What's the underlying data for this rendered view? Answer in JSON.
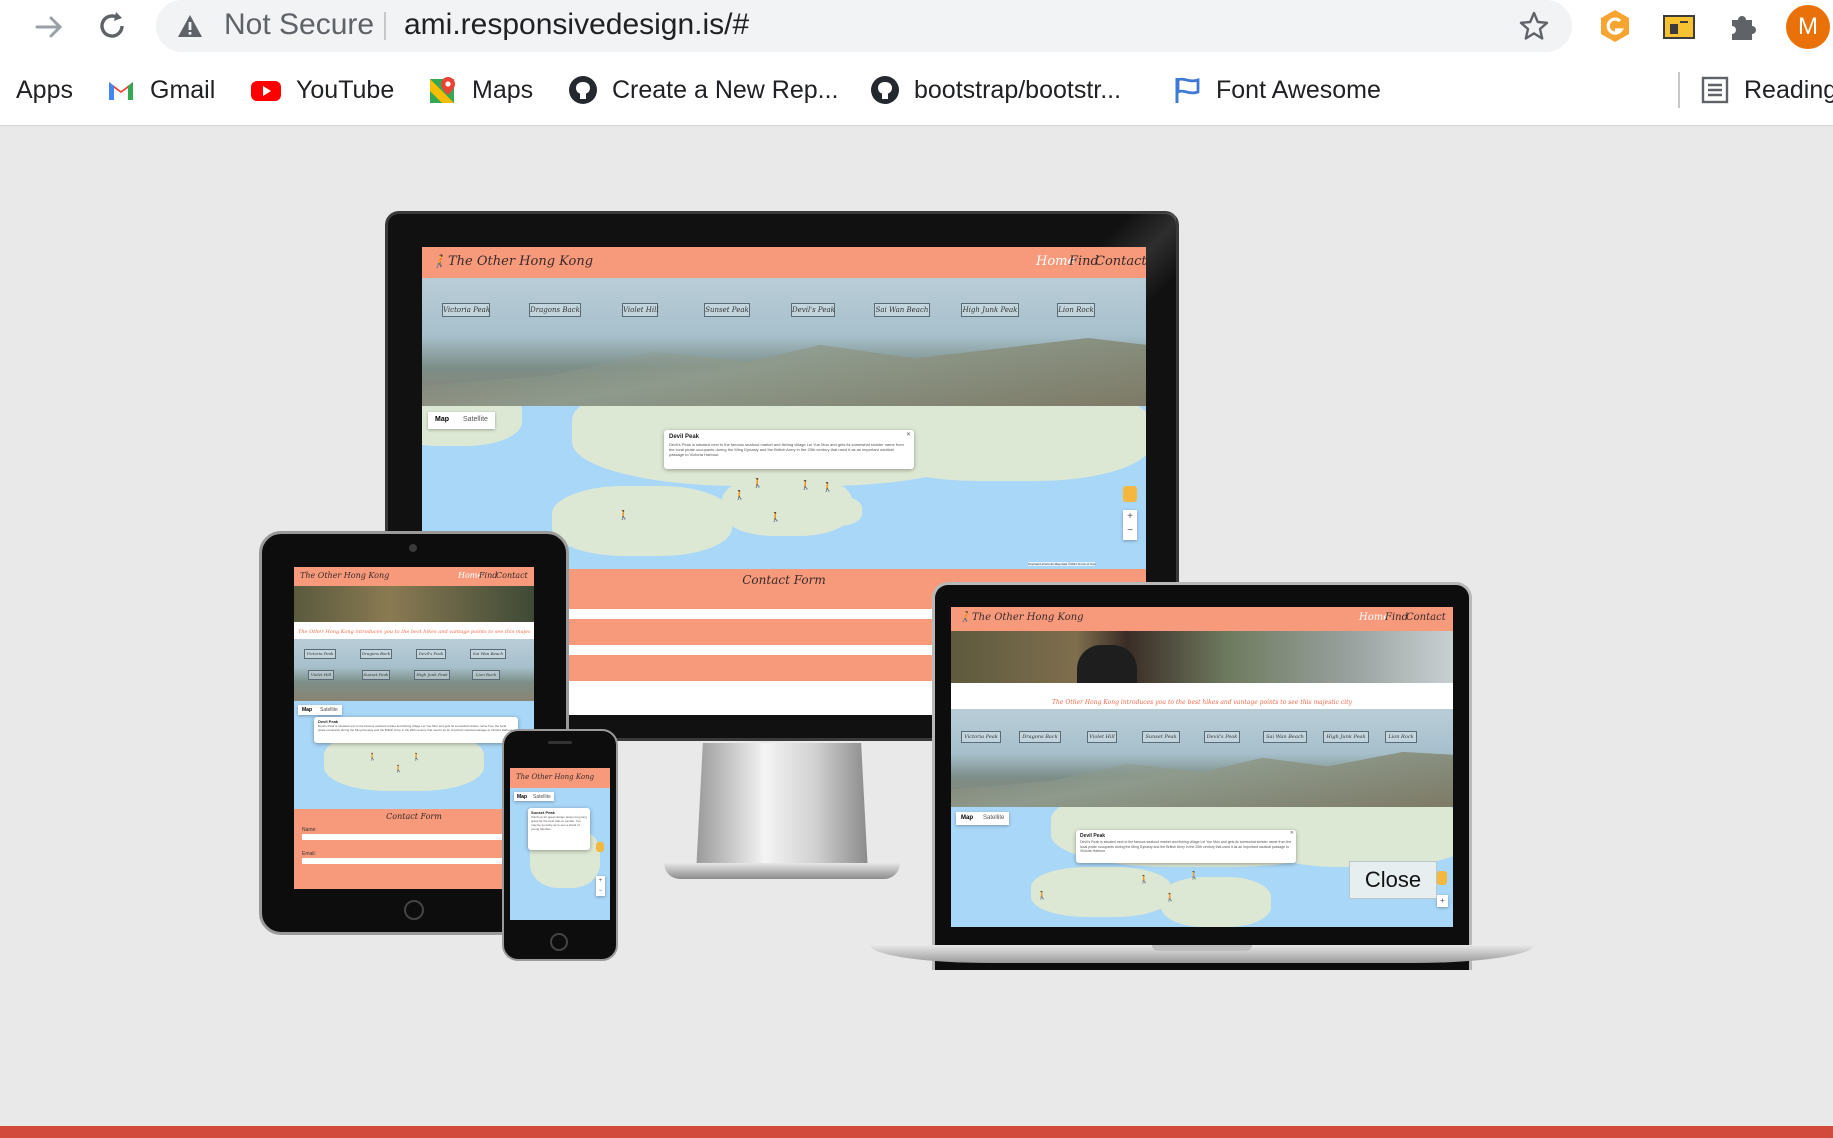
{
  "browser": {
    "security_label": "Not Secure",
    "url": "ami.responsivedesign.is/#",
    "profile_initial": "M",
    "bookmarks": [
      {
        "label": "Apps"
      },
      {
        "label": "Gmail"
      },
      {
        "label": "YouTube"
      },
      {
        "label": "Maps"
      },
      {
        "label": "Create a New Rep..."
      },
      {
        "label": "bootstrap/bootstr..."
      },
      {
        "label": "Font Awesome"
      }
    ],
    "reading_list": "Reading"
  },
  "site": {
    "brand": "The Other Hong Kong",
    "nav_home": "Home",
    "nav_find": "Find",
    "nav_contact": "Contact",
    "tagline": "The Other Hong Kong introduces you to the best hikes and vantage points to see this majestic city",
    "peaks": [
      "Victoria Peak",
      "Dragons Back",
      "Violet Hill",
      "Sunset Peak",
      "Devil's Peak",
      "Sai Wan Beach",
      "High Junk Peak",
      "Lion Rock"
    ],
    "map_btn": "Map",
    "satellite_btn": "Satellite",
    "popup_title": "Devil Peak",
    "popup_text": "Devil's Peak is situated next to the famous seafood market and fishing village Lei Yue Mun and gets its somewhat sinister name from the local pirate occupants during the Ming Dynasty and the British Army in the 20th century that used it as an important nautical passage to Victoria Harbour.",
    "phone_popup_title": "Sunset Peak",
    "phone_popup_text": "Climb up for great ratings. Enjoy long long grass far the best trail on Lantau. You may be so lucky as to see a stand of young bamboo.",
    "contact_form": "Contact Form",
    "name_label": "Name:",
    "email_label": "Email:",
    "zoom_in": "+",
    "zoom_out": "−",
    "map_footer": "Keyboard shortcuts   Map data ©2021   Terms of Use",
    "close_btn": "Close"
  },
  "colors": {
    "accent": "#f79a7c",
    "page_bg": "#e9e9e9",
    "bottom_bar": "#d24a3c",
    "map_water": "#a9d7f8",
    "profile": "#e8710a"
  }
}
